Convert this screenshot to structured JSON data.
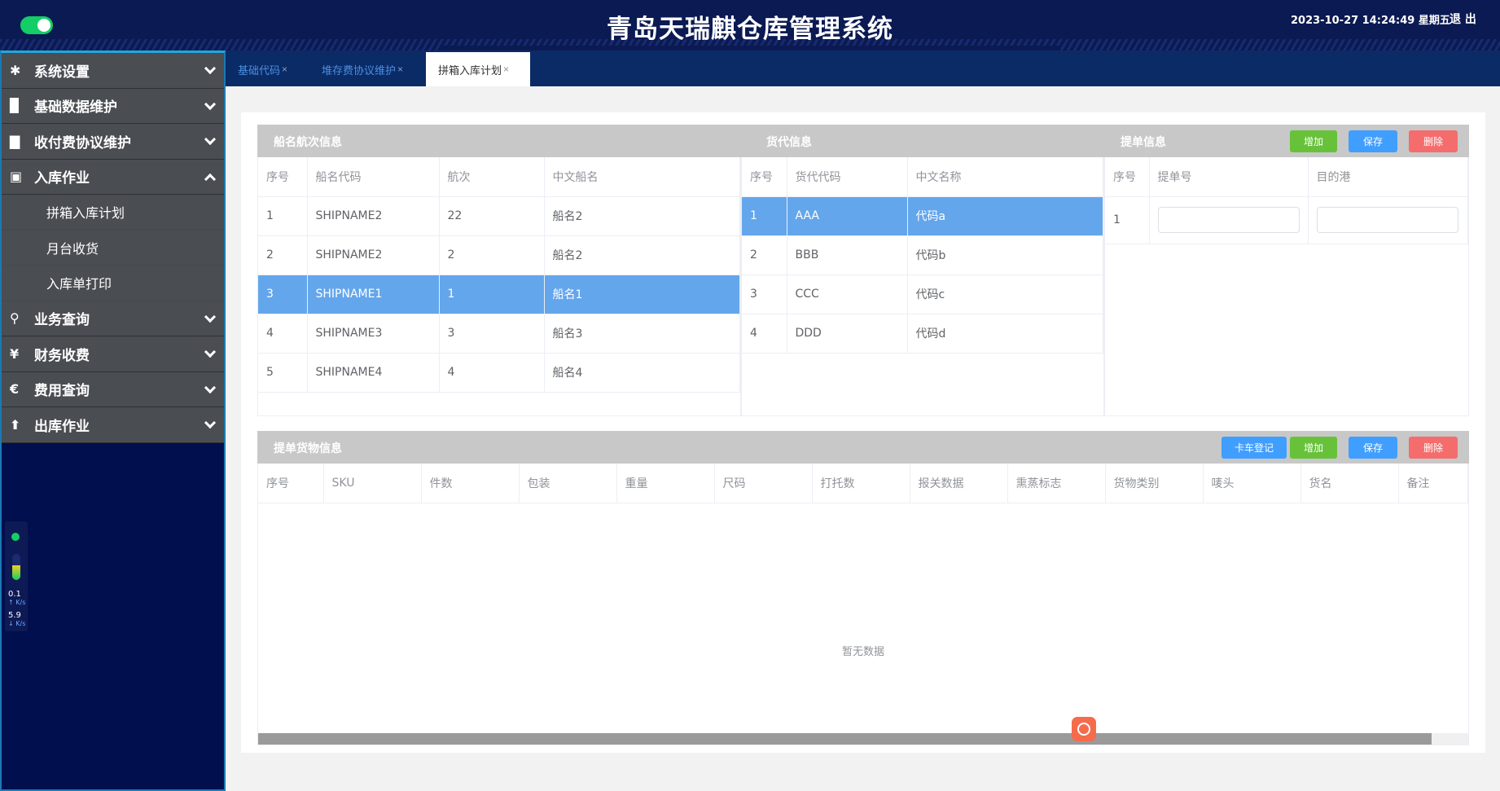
{
  "header": {
    "title": "青岛天瑞麒仓库管理系统",
    "datetime": "2023-10-27 14:24:49 星期五",
    "logout": "退 出"
  },
  "sidebar": {
    "items": [
      {
        "label": "系统设置",
        "icon": "gear-icon",
        "expanded": false
      },
      {
        "label": "基础数据维护",
        "icon": "book-icon",
        "expanded": false
      },
      {
        "label": "收付费协议维护",
        "icon": "document-icon",
        "expanded": false
      },
      {
        "label": "入库作业",
        "icon": "inbox-icon",
        "expanded": true,
        "children": [
          {
            "label": "拼箱入库计划"
          },
          {
            "label": "月台收货"
          },
          {
            "label": "入库单打印"
          }
        ]
      },
      {
        "label": "业务查询",
        "icon": "search-icon",
        "expanded": false
      },
      {
        "label": "财务收费",
        "icon": "yen-icon",
        "expanded": false
      },
      {
        "label": "费用查询",
        "icon": "euro-icon",
        "expanded": false
      },
      {
        "label": "出库作业",
        "icon": "upload-icon",
        "expanded": false
      }
    ]
  },
  "network": {
    "up_value": "0.1",
    "up_unit": "K/s",
    "down_value": "5.9",
    "down_unit": "K/s",
    "level": 0.55
  },
  "tabs": [
    {
      "label": "基础代码",
      "active": false
    },
    {
      "label": "堆存费协议维护",
      "active": false
    },
    {
      "label": "拼箱入库计划",
      "active": true
    }
  ],
  "top_panel": {
    "ship_title": "船名航次信息",
    "forwarder_title": "货代信息",
    "bill_title": "提单信息",
    "buttons": {
      "add": "增加",
      "save": "保存",
      "delete": "删除"
    },
    "ship_table": {
      "columns": [
        "序号",
        "船名代码",
        "航次",
        "中文船名"
      ],
      "rows": [
        [
          "1",
          "SHIPNAME2",
          "22",
          "船名2"
        ],
        [
          "2",
          "SHIPNAME2",
          "2",
          "船名2"
        ],
        [
          "3",
          "SHIPNAME1",
          "1",
          "船名1"
        ],
        [
          "4",
          "SHIPNAME3",
          "3",
          "船名3"
        ],
        [
          "5",
          "SHIPNAME4",
          "4",
          "船名4"
        ]
      ],
      "selected_row": 2
    },
    "forwarder_table": {
      "columns": [
        "序号",
        "货代代码",
        "中文名称"
      ],
      "rows": [
        [
          "1",
          "AAA",
          "代码a"
        ],
        [
          "2",
          "BBB",
          "代码b"
        ],
        [
          "3",
          "CCC",
          "代码c"
        ],
        [
          "4",
          "DDD",
          "代码d"
        ]
      ],
      "selected_row": 0
    },
    "bill_table": {
      "columns": [
        "序号",
        "提单号",
        "目的港"
      ],
      "rows": [
        {
          "index": "1",
          "bill_no": "",
          "port": ""
        }
      ]
    }
  },
  "bottom_panel": {
    "title": "提单货物信息",
    "buttons": {
      "truck": "卡车登记",
      "add": "增加",
      "save": "保存",
      "delete": "删除"
    },
    "columns": [
      "序号",
      "SKU",
      "件数",
      "包装",
      "重量",
      "尺码",
      "打托数",
      "报关数据",
      "熏蒸标志",
      "货物类别",
      "唛头",
      "货名",
      "备注"
    ],
    "empty_text": "暂无数据",
    "scroll_fraction": 0.97
  }
}
